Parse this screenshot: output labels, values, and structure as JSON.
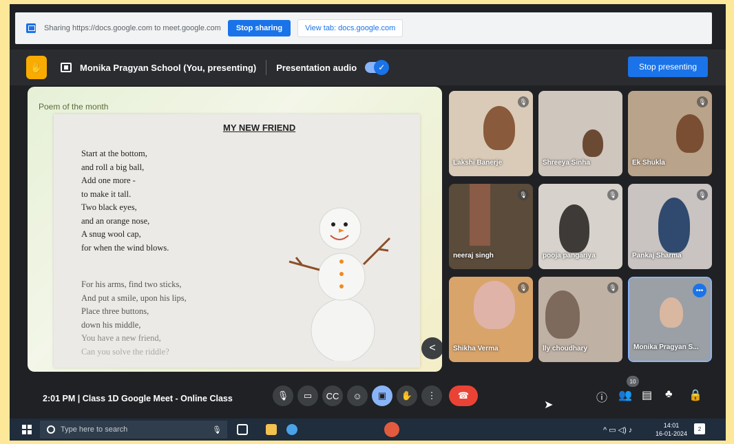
{
  "sharing_bar": {
    "text": "Sharing https://docs.google.com to meet.google.com",
    "stop_sharing": "Stop sharing",
    "view_tab": "View tab: docs.google.com"
  },
  "presenting_bar": {
    "title": "Monika Pragyan School (You, presenting)",
    "audio_label": "Presentation audio",
    "audio_on": true,
    "stop_presenting": "Stop presenting"
  },
  "slide": {
    "label": "Poem of the month",
    "poem_title": "MY NEW FRIEND",
    "stanza1": [
      "Start at the bottom,",
      "and roll a big ball,",
      "Add one more -",
      "to make it tall.",
      "Two black eyes,",
      "and an orange nose,",
      "A snug wool cap,",
      "for when the wind blows."
    ],
    "stanza2": [
      "For his arms, find two sticks,",
      "And put a smile, upon his lips,",
      "Place three buttons,",
      "down his middle,",
      "You have a new friend,",
      "Can you solve the riddle?"
    ]
  },
  "participants": [
    {
      "name": "Lakshita Banerjee",
      "visible_name": "Lakshi  Banerje",
      "bg": "#d9cbb8",
      "skin": "#8a5a3c"
    },
    {
      "name": "Shreeya Sinha",
      "visible_name": "Shreeya Sinha",
      "bg": "#cfc6bd",
      "skin": "#6b4a34"
    },
    {
      "name": "Ekta Shukla",
      "visible_name": "Ek   Shukla",
      "bg": "#b9a38a",
      "skin": "#7a4e32"
    },
    {
      "name": "neeraj singh",
      "visible_name": "neeraj singh",
      "bg": "#5b4b3a",
      "skin": "#6e4a2f"
    },
    {
      "name": "pooja pangariya",
      "visible_name": "pooja pangariya",
      "bg": "#d7d2cc",
      "skin": "#3d3a38"
    },
    {
      "name": "Pankaj Sharma",
      "visible_name": "Pankaj Sharma",
      "bg": "#c9c3c2",
      "skin": "#2f4a6e"
    },
    {
      "name": "Shikha Verma",
      "visible_name": "Shikha Verma",
      "bg": "#d9a46a",
      "skin": "#e0b3a8"
    },
    {
      "name": "Shelly choudhary",
      "visible_name": "  lly choudhary",
      "bg": "#bfb1a4",
      "skin": "#7d6a5c"
    },
    {
      "name": "Monika Pragyan S...",
      "visible_name": "Monika Pragyan S...",
      "bg": "#9aa0a6",
      "skin": "#d9b7a0"
    }
  ],
  "controls": {
    "time": "2:01 PM",
    "separator": "|",
    "meeting_name": "Class 1D Google Meet - Online Class",
    "people_count": "10"
  },
  "taskbar": {
    "search_placeholder": "Type here to search",
    "time": "14:01",
    "date": "16-01-2024",
    "notifications": "2"
  },
  "colors": {
    "meet_bg": "#202124",
    "accent": "#1a73e8",
    "end_call": "#ea4335",
    "active_control": "#8ab4f8"
  }
}
